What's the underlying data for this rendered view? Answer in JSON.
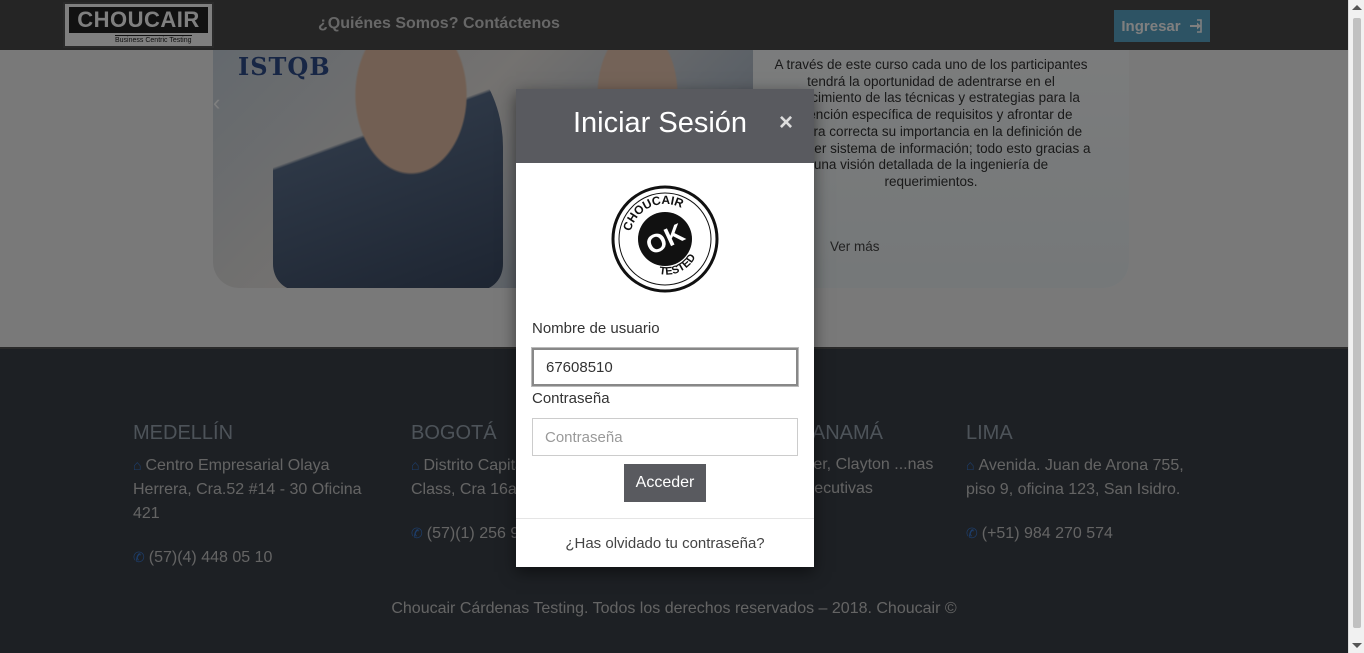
{
  "navbar": {
    "logo_text": "CHOUCAIR",
    "logo_subtitle": "Business Centric Testing",
    "links": [
      "¿Quiénes Somos?",
      "Contáctenos"
    ],
    "login_button": "Ingresar"
  },
  "hero": {
    "badge": "ISTQB",
    "description": "A través de este curso cada uno de los participantes tendrá la oportunidad de adentrarse en el conocimiento de las técnicas y estrategias para la obtención específica de requisitos y afrontar de manera correcta su importancia en la definición de cualquier sistema de información; todo esto gracias a una visión detallada de la ingeniería de requerimientos.",
    "more_link": "Ver más"
  },
  "footer": {
    "offices": [
      {
        "city": "MEDELLÍN",
        "address": "Centro Empresarial Olaya Herrera, Cra.52 #14 - 30 Oficina 421",
        "phone": "(57)(4) 448 05 10"
      },
      {
        "city": "BOGOTÁ",
        "address": "Distrito Capital World Business Class, Cra 16a #",
        "phone": "(57)(1) 256 9"
      },
      {
        "city": "PANAMÁ",
        "address": "...er, Clayton ...nas Ejecutivas",
        "phone": ""
      },
      {
        "city": "LIMA",
        "address": "Avenida. Juan de Arona 755, piso 9, oficina 123, San Isidro.",
        "phone": "(+51) 984 270 574"
      }
    ],
    "copyright": "Choucair Cárdenas Testing. Todos los derechos reservados – 2018. Choucair ©"
  },
  "modal": {
    "title": "Iniciar Sesión",
    "close_symbol": "×",
    "logo_text_top": "CHOUCAIR",
    "logo_text_center": "OK",
    "logo_text_bottom": "TESTED",
    "username_label": "Nombre de usuario",
    "username_value": "67608510",
    "password_label": "Contraseña",
    "password_placeholder": "Contraseña",
    "submit_button": "Acceder",
    "forgot_link": "¿Has olvidado tu contraseña?"
  },
  "colors": {
    "navbar": "#4a4a4a",
    "modal_header": "#595a5f",
    "login_button": "#5aa6c8",
    "footer": "#3b4048",
    "icon_blue": "#3a7dd8"
  }
}
